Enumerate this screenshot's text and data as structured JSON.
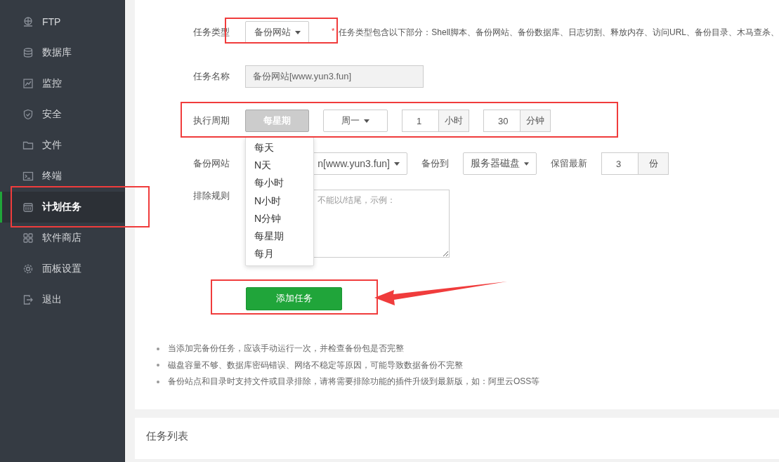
{
  "sidebar": {
    "items": [
      {
        "label": "FTP",
        "selected": false
      },
      {
        "label": "数据库",
        "selected": false
      },
      {
        "label": "监控",
        "selected": false
      },
      {
        "label": "安全",
        "selected": false
      },
      {
        "label": "文件",
        "selected": false
      },
      {
        "label": "终端",
        "selected": false
      },
      {
        "label": "计划任务",
        "selected": true
      },
      {
        "label": "软件商店",
        "selected": false
      },
      {
        "label": "面板设置",
        "selected": false
      },
      {
        "label": "退出",
        "selected": false
      }
    ]
  },
  "form": {
    "task_type": {
      "label": "任务类型",
      "value": "备份网站",
      "required_mark": "*",
      "hint": "任务类型包含以下部分：Shell脚本、备份网站、备份数据库、日志切割、释放内存、访问URL、备份目录、木马查杀、"
    },
    "task_name": {
      "label": "任务名称",
      "value": "备份网站[www.yun3.fun]"
    },
    "schedule": {
      "label": "执行周期",
      "period": "每星期",
      "weekday": "周一",
      "hour": "1",
      "hour_unit": "小时",
      "minute": "30",
      "minute_unit": "分钟",
      "menu": [
        "每天",
        "N天",
        "每小时",
        "N小时",
        "N分钟",
        "每星期",
        "每月"
      ]
    },
    "backup_site": {
      "label": "备份网站",
      "value": "n[www.yun3.fun]"
    },
    "backup_to": {
      "label": "备份到",
      "value": "服务器磁盘"
    },
    "keep": {
      "label": "保留最新",
      "value": "3",
      "unit": "份"
    },
    "exclude": {
      "label": "排除规则",
      "placeholder": "不能以/结尾，示例："
    },
    "submit": "添加任务"
  },
  "notes": [
    "当添加完备份任务，应该手动运行一次，并检查备份包是否完整",
    "磁盘容量不够、数据库密码错误、网络不稳定等原因，可能导致数据备份不完整",
    "备份站点和目录时支持文件或目录排除，请将需要排除功能的插件升级到最新版，如：阿里云OSS等"
  ],
  "task_list": {
    "title": "任务列表"
  }
}
